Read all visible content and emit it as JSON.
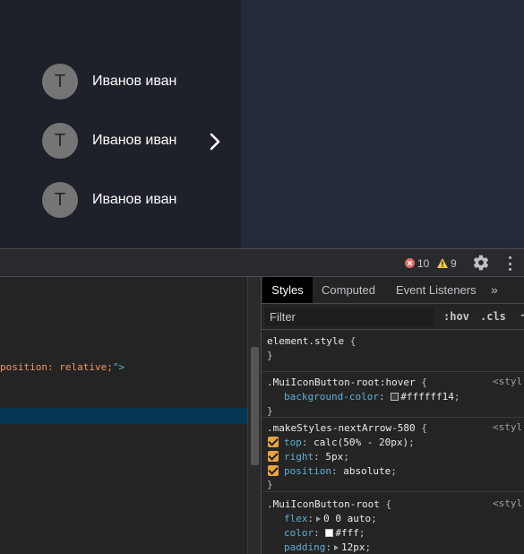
{
  "app": {
    "users": [
      {
        "avatar_letter": "T",
        "name": "Иванов иван"
      },
      {
        "avatar_letter": "T",
        "name": "Иванов иван"
      },
      {
        "avatar_letter": "T",
        "name": "Иванов иван"
      }
    ],
    "next_arrow_icon": "chevron-right-icon"
  },
  "devtools": {
    "toolbar": {
      "errors_count": "10",
      "warnings_count": "9",
      "error_icon": "error-circle-icon",
      "warning_icon": "warning-triangle-icon",
      "settings_icon": "gear-icon",
      "more_icon": "kebab-menu-icon"
    },
    "elements": {
      "attr_fragment": "position: relative;",
      "tag_end": "\">"
    },
    "styles": {
      "tabs": [
        "Styles",
        "Computed",
        "Event Listeners",
        "»"
      ],
      "active_tab": "Styles",
      "filter_placeholder": "Filter",
      "hov_label": ":hov",
      "cls_label": ".cls",
      "add_label": "+",
      "rules": [
        {
          "selector": "element.style",
          "open": "{",
          "close": "}"
        },
        {
          "selector": ".MuiIconButton-root:hover",
          "open": "{",
          "source": "<styl",
          "props": [
            {
              "name": "background-color",
              "value": "#ffffff14",
              "swatch": "#3b3b3b"
            }
          ],
          "close": "}"
        },
        {
          "selector": ".makeStyles-nextArrow-580",
          "open": "{",
          "source": "<styl",
          "props": [
            {
              "name": "top",
              "value": "calc(50% - 20px)",
              "checked": true
            },
            {
              "name": "right",
              "value": "5px",
              "checked": true
            },
            {
              "name": "position",
              "value": "absolute",
              "checked": true
            }
          ],
          "close": "}"
        },
        {
          "selector": ".MuiIconButton-root",
          "open": "{",
          "source": "<styl",
          "props": [
            {
              "name": "flex",
              "value": "0 0 auto"
            },
            {
              "name": "color",
              "value": "#fff",
              "swatch": "#ffffff"
            },
            {
              "name": "padding",
              "value": "12px"
            }
          ]
        }
      ]
    }
  },
  "colors": {
    "list_bg": "#1f212a",
    "content_bg": "#232a3b",
    "avatar_bg": "#757575",
    "devtools_bg": "#242424",
    "selection_bg": "#073655",
    "checkbox": "#e8a33d",
    "prop_name": "#5db0d7"
  }
}
